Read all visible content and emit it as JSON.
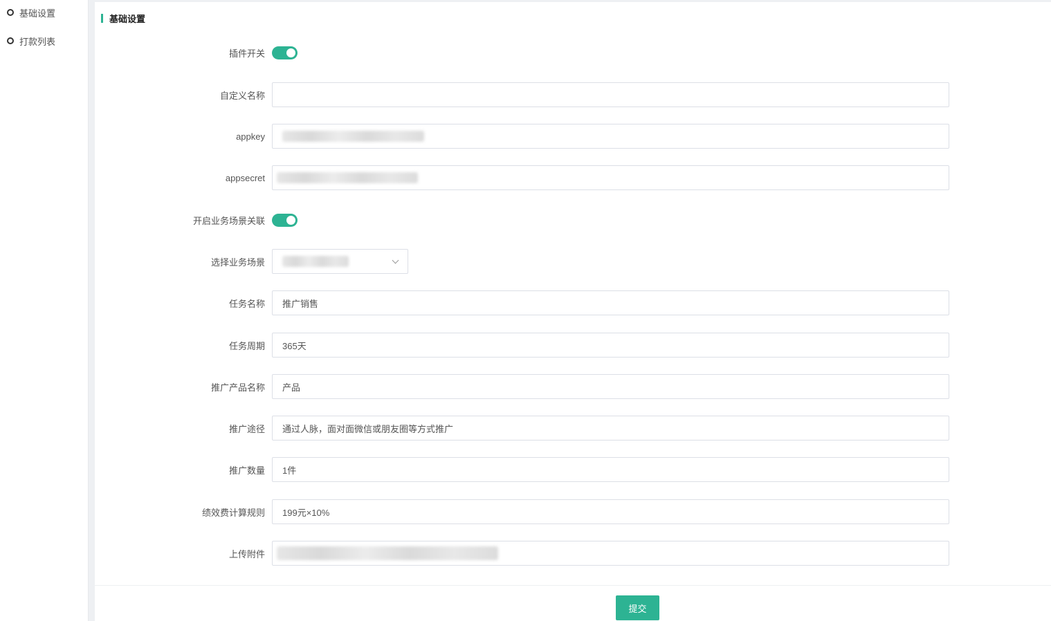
{
  "sidebar": {
    "items": [
      {
        "label": "基础设置"
      },
      {
        "label": "打款列表"
      }
    ]
  },
  "section": {
    "title": "基础设置"
  },
  "form": {
    "plugin_switch": {
      "label": "插件开关",
      "on": true
    },
    "custom_name": {
      "label": "自定义名称",
      "value": ""
    },
    "appkey": {
      "label": "appkey"
    },
    "appsecret": {
      "label": "appsecret"
    },
    "scene_switch": {
      "label": "开启业务场景关联",
      "on": true
    },
    "scene_select": {
      "label": "选择业务场景"
    },
    "task_name": {
      "label": "任务名称",
      "value": "推广销售"
    },
    "task_period": {
      "label": "任务周期",
      "value": "365天"
    },
    "product_name": {
      "label": "推广产品名称",
      "value": "产品"
    },
    "channel": {
      "label": "推广途径",
      "value": "通过人脉，面对面微信或朋友圈等方式推广"
    },
    "quantity": {
      "label": "推广数量",
      "value": "1件"
    },
    "fee_rule": {
      "label": "绩效费计算规则",
      "value": "199元×10%"
    },
    "attachment": {
      "label": "上传附件"
    }
  },
  "footer": {
    "submit_label": "提交"
  },
  "colors": {
    "accent": "#2db393"
  }
}
